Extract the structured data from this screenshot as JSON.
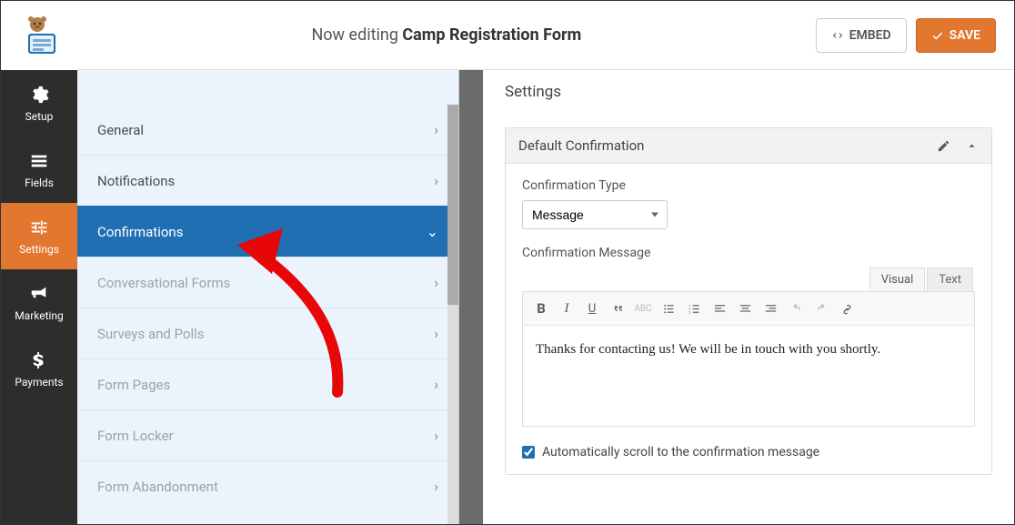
{
  "topbar": {
    "editing_prefix": "Now editing ",
    "form_name": "Camp Registration Form",
    "embed_label": "EMBED",
    "save_label": "SAVE"
  },
  "leftnav": {
    "items": [
      {
        "key": "setup",
        "label": "Setup"
      },
      {
        "key": "fields",
        "label": "Fields"
      },
      {
        "key": "settings",
        "label": "Settings",
        "active": true
      },
      {
        "key": "marketing",
        "label": "Marketing"
      },
      {
        "key": "payments",
        "label": "Payments"
      }
    ]
  },
  "sub_settings": {
    "items": [
      {
        "label": "General",
        "chev": "›"
      },
      {
        "label": "Notifications",
        "chev": "›"
      },
      {
        "label": "Confirmations",
        "chev": "⌄",
        "selected": true
      },
      {
        "label": "Conversational Forms",
        "chev": "›",
        "disabled": true
      },
      {
        "label": "Surveys and Polls",
        "chev": "›",
        "disabled": true
      },
      {
        "label": "Form Pages",
        "chev": "›",
        "disabled": true
      },
      {
        "label": "Form Locker",
        "chev": "›",
        "disabled": true
      },
      {
        "label": "Form Abandonment",
        "chev": "›",
        "disabled": true
      }
    ]
  },
  "main": {
    "page_title": "Settings",
    "card_title": "Default Confirmation",
    "type_label": "Confirmation Type",
    "type_selected": "Message",
    "message_label": "Confirmation Message",
    "editor_tabs": {
      "visual": "Visual",
      "text": "Text",
      "active": "visual"
    },
    "message_body": "Thanks for contacting us! We will be in touch with you shortly.",
    "autoscroll_label": "Automatically scroll to the confirmation message",
    "autoscroll_checked": true
  },
  "toolbar_buttons": [
    "bold",
    "italic",
    "underline",
    "quote",
    "strike",
    "ul",
    "ol",
    "align-left",
    "align-center",
    "align-right",
    "undo",
    "redo",
    "link"
  ]
}
